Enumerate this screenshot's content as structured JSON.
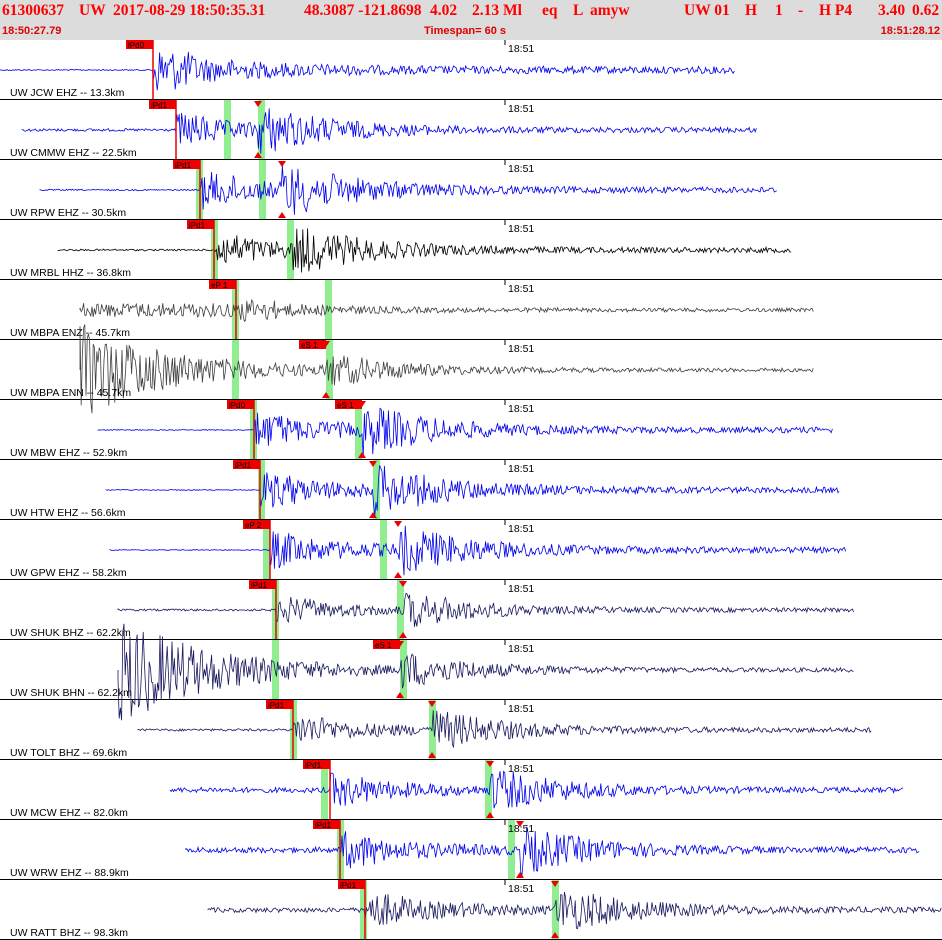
{
  "header": {
    "event_id": "61300637",
    "network": "UW",
    "datetime": "2017-08-29 18:50:35.31",
    "location": "48.3087 -121.8698",
    "depth": "4.02",
    "magnitude": "2.13 Ml",
    "event_type": "eq",
    "geo_type": "L",
    "author": "amyw",
    "origin_source": "UW 01",
    "h_flag": "H",
    "version": "1",
    "dash": "-",
    "processing": "H P4",
    "rms": "3.40",
    "erh": "0.62",
    "start_time": "18:50:27.79",
    "timespan": "Timespan=  60 s",
    "end_time": "18:51:28.12"
  },
  "colors": {
    "header_bg": "#dcdcdc",
    "header_text": "#ff0000",
    "blue_trace": "#0000ee",
    "black_trace": "#000000",
    "gray_trace": "#404040",
    "navy_trace": "#1a1a60",
    "pick_box": "#ee0000",
    "pick_window": "#90ee90"
  },
  "minute_label": "18:51",
  "traces": [
    {
      "label": "UW JCW EHZ -- 13.3km",
      "color": "blue",
      "pick": "iPd0",
      "p_start": "18:50:35.31"
    },
    {
      "label": "UW CMMW EHZ -- 22.5km",
      "color": "blue",
      "pick": "iPd1"
    },
    {
      "label": "UW RPW EHZ -- 30.5km",
      "color": "blue",
      "pick": "iPd1"
    },
    {
      "label": "UW MRBL HHZ -- 36.8km",
      "color": "black",
      "pick": "iPd1"
    },
    {
      "label": "UW MBPA ENZ -- 45.7km",
      "color": "gray",
      "pick": "eP 1"
    },
    {
      "label": "UW MBPA ENN -- 45.7km",
      "color": "gray",
      "pick": "eS 1"
    },
    {
      "label": "UW MBW EHZ -- 52.9km",
      "color": "blue",
      "pick": "iPd0",
      "spick": "eS 1"
    },
    {
      "label": "UW HTW EHZ -- 56.6km",
      "color": "blue",
      "pick": "iPd1"
    },
    {
      "label": "UW GPW EHZ -- 58.2km",
      "color": "blue",
      "pick": "eP 2"
    },
    {
      "label": "UW SHUK BHZ -- 62.2km",
      "color": "navy",
      "pick": "iPd1"
    },
    {
      "label": "UW SHUK BHN -- 62.2km",
      "color": "navy",
      "pick": "eS 1"
    },
    {
      "label": "UW TOLT BHZ -- 69.6km",
      "color": "navy",
      "pick": "iPd1"
    },
    {
      "label": "UW MCW EHZ -- 82.0km",
      "color": "blue",
      "pick": "iPd1"
    },
    {
      "label": "UW WRW EHZ -- 88.9km",
      "color": "blue",
      "pick": "iPd1"
    },
    {
      "label": "UW RATT BHZ -- 98.3km",
      "color": "navy",
      "pick": "iPd1"
    }
  ]
}
